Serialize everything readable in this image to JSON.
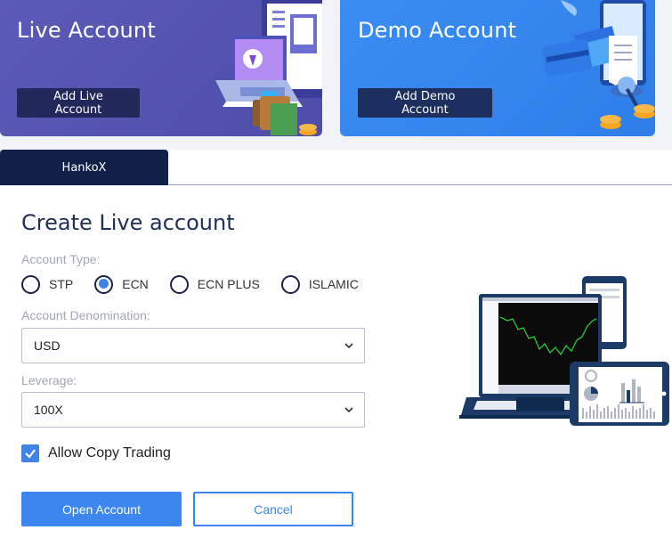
{
  "cards": {
    "live": {
      "title": "Live Account",
      "button_label": "Add Live Account"
    },
    "demo": {
      "title": "Demo Account",
      "button_label": "Add Demo Account"
    }
  },
  "tabs": [
    {
      "label": "HankoX",
      "active": true
    }
  ],
  "form": {
    "title": "Create Live account",
    "account_type": {
      "label": "Account Type:",
      "options": [
        "STP",
        "ECN",
        "ECN PLUS",
        "ISLAMIC"
      ],
      "selected": "ECN"
    },
    "denomination": {
      "label": "Account Denomination:",
      "value": "USD"
    },
    "leverage": {
      "label": "Leverage:",
      "value": "100X"
    },
    "copy_trading": {
      "label": "Allow Copy Trading",
      "checked": true
    },
    "open_button": "Open Account",
    "cancel_button": "Cancel"
  },
  "icons": {
    "chevron": "chevron-down-icon",
    "check": "checkmark-icon"
  },
  "colors": {
    "live_card": "#5353ac",
    "demo_card": "#3287ed",
    "dark_navy": "#0f2146",
    "accent_blue": "#3b87ef"
  }
}
